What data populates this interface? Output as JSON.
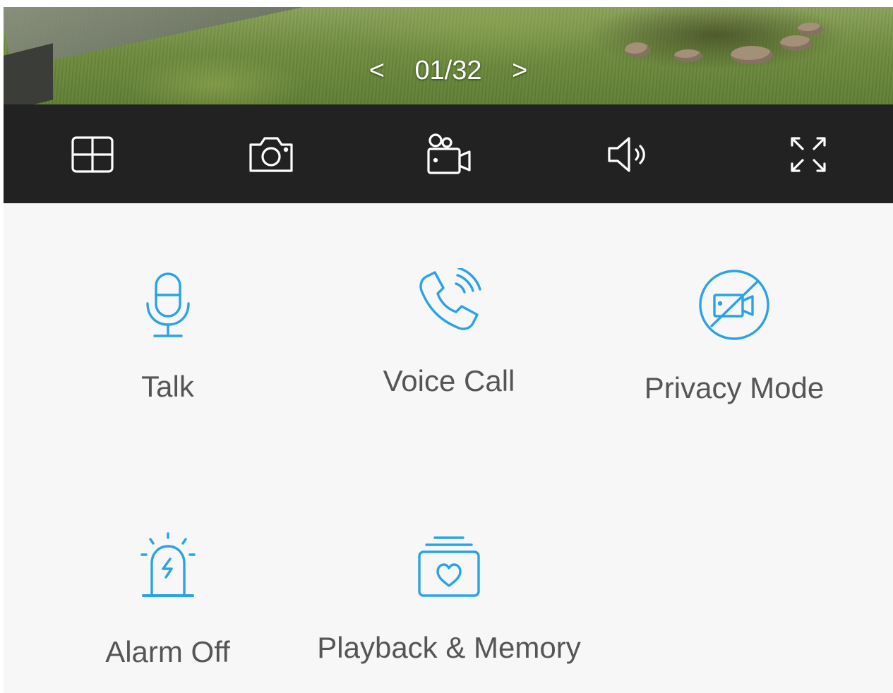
{
  "feed": {
    "pager": {
      "prev": "<",
      "current": "01/32",
      "next": ">"
    }
  },
  "toolbar": {
    "items": [
      {
        "name": "layout",
        "icon": "grid-layout-icon"
      },
      {
        "name": "snapshot",
        "icon": "camera-icon"
      },
      {
        "name": "record",
        "icon": "video-record-icon"
      },
      {
        "name": "sound",
        "icon": "speaker-icon"
      },
      {
        "name": "fullscreen",
        "icon": "fullscreen-icon"
      }
    ]
  },
  "actions": [
    {
      "label": "Talk",
      "icon": "microphone-icon"
    },
    {
      "label": "Voice Call",
      "icon": "phone-call-icon"
    },
    {
      "label": "Privacy Mode",
      "icon": "video-off-icon"
    },
    {
      "label": "Alarm Off",
      "icon": "alarm-siren-icon"
    },
    {
      "label": "Playback & Memory",
      "icon": "heart-album-icon"
    }
  ],
  "colors": {
    "accent": "#29a3e8",
    "toolbar_bg": "#222222",
    "label_text": "#555555",
    "panel_bg": "#f7f7f7"
  }
}
